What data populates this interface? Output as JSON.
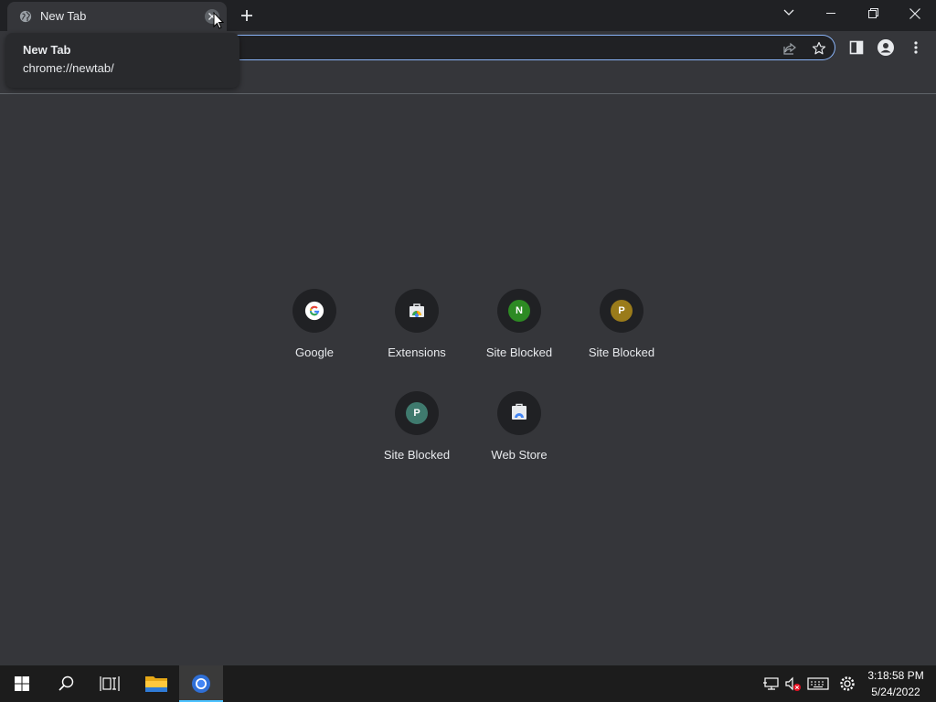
{
  "tab": {
    "title": "New Tab",
    "close_label": "Close"
  },
  "tooltip": {
    "title": "New Tab",
    "url": "chrome://newtab/"
  },
  "shortcuts": [
    {
      "label": "Google",
      "icon": "google-icon"
    },
    {
      "label": "Extensions",
      "icon": "extensions-icon"
    },
    {
      "label": "Site Blocked",
      "letter": "N",
      "color": "#2d8a23"
    },
    {
      "label": "Site Blocked",
      "letter": "P",
      "color": "#9a7b1a"
    },
    {
      "label": "Site Blocked",
      "letter": "P",
      "color": "#3f7a6e"
    },
    {
      "label": "Web Store",
      "icon": "web-store-icon"
    }
  ],
  "taskbar": {
    "time": "3:18:58 PM",
    "date": "5/24/2022"
  },
  "colors": {
    "accent": "#8ab4f8",
    "taskbar_active": "#4cc2ff"
  }
}
